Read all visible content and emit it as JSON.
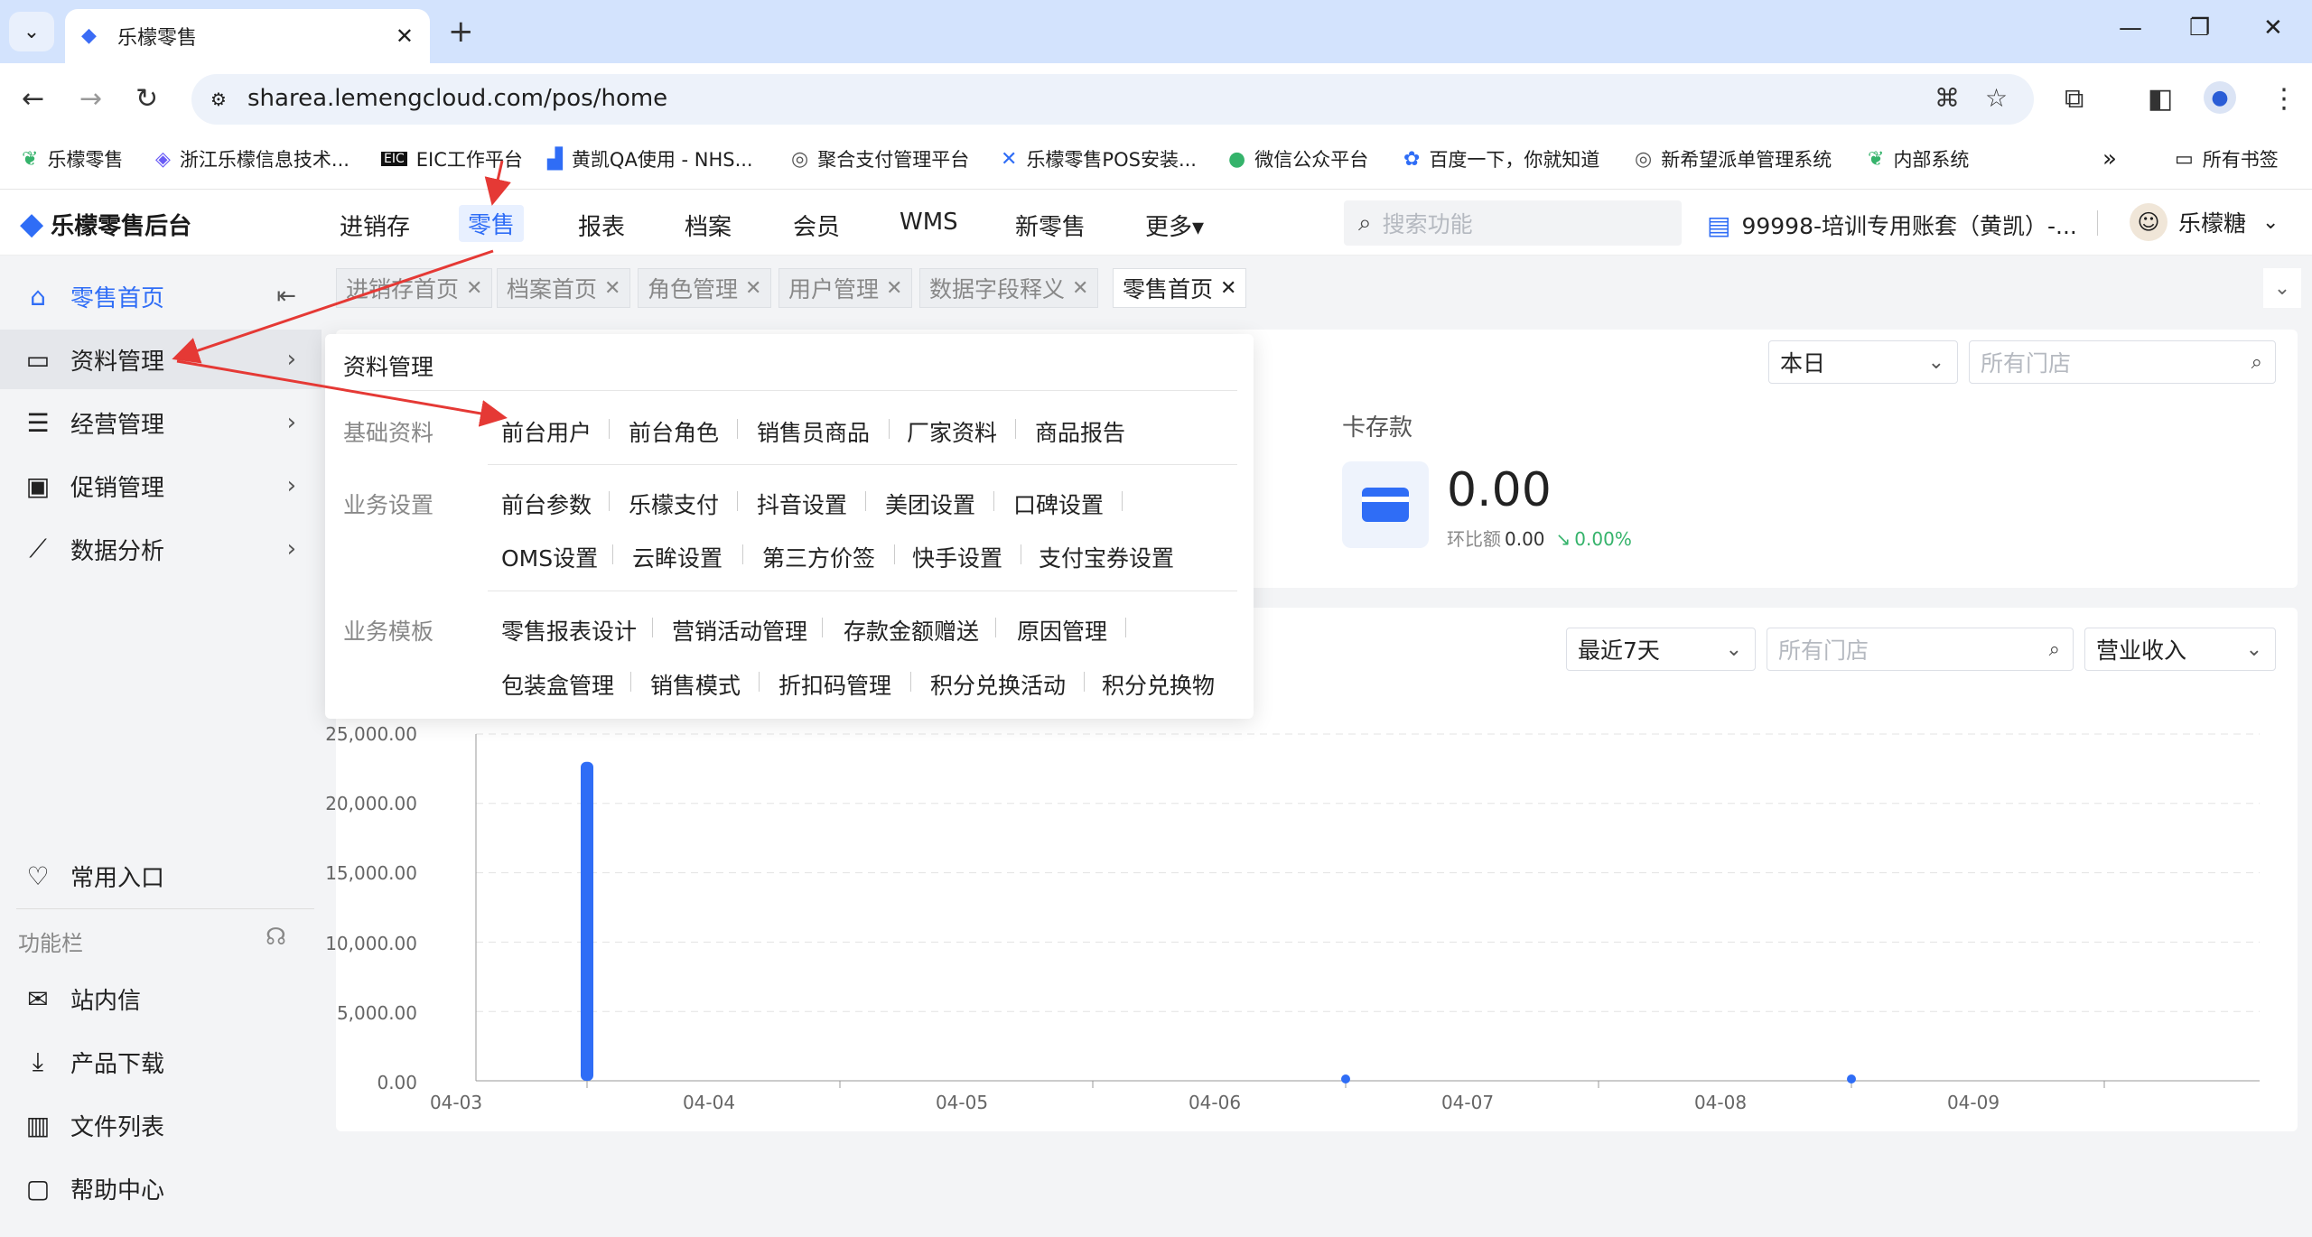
{
  "browser": {
    "tab_title": "乐檬零售",
    "url": "sharea.lemengcloud.com/pos/home",
    "bookmarks": [
      {
        "label": "乐檬零售",
        "icon": "lemon-leaf-icon"
      },
      {
        "label": "浙江乐檬信息技术...",
        "icon": "lemon-square-icon"
      },
      {
        "label": "EIC工作平台",
        "icon": "eic-icon"
      },
      {
        "label": "黄凯QA使用 - NHS...",
        "icon": "bar-icon"
      },
      {
        "label": "聚合支付管理平台",
        "icon": "globe-icon"
      },
      {
        "label": "乐檬零售POS安装...",
        "icon": "butterfly-icon"
      },
      {
        "label": "微信公众平台",
        "icon": "wechat-icon"
      },
      {
        "label": "百度一下，你就知道",
        "icon": "baidu-icon"
      },
      {
        "label": "新希望派单管理系统",
        "icon": "globe-icon"
      },
      {
        "label": "内部系统",
        "icon": "lemon-leaf-icon"
      }
    ],
    "all_bookmarks": "所有书签"
  },
  "app": {
    "brand": "乐檬零售后台",
    "nav": [
      "进销存",
      "零售",
      "报表",
      "档案",
      "会员",
      "WMS",
      "新零售",
      "更多▾"
    ],
    "search_placeholder": "搜索功能",
    "account": "99998-培训专用账套（黄凯）-...",
    "user": "乐檬糖"
  },
  "sidebar": {
    "items": [
      {
        "label": "零售首页",
        "icon": "home-icon"
      },
      {
        "label": "资料管理",
        "icon": "folder-icon"
      },
      {
        "label": "经营管理",
        "icon": "manage-icon"
      },
      {
        "label": "促销管理",
        "icon": "promo-icon"
      },
      {
        "label": "数据分析",
        "icon": "chart-line-icon"
      }
    ],
    "favorites": "常用入口",
    "section_label": "功能栏",
    "bottom_items": [
      {
        "label": "站内信",
        "icon": "mail-icon"
      },
      {
        "label": "产品下载",
        "icon": "download-icon"
      },
      {
        "label": "文件列表",
        "icon": "file-list-icon"
      },
      {
        "label": "帮助中心",
        "icon": "help-icon"
      }
    ]
  },
  "page_tabs": [
    "进销存首页",
    "档案首页",
    "角色管理",
    "用户管理",
    "数据字段释义",
    "零售首页"
  ],
  "dropdown": {
    "title": "资料管理",
    "groups": [
      {
        "label": "基础资料",
        "links": [
          "前台用户",
          "前台角色",
          "销售员商品",
          "厂家资料",
          "商品报告"
        ]
      },
      {
        "label": "业务设置",
        "links": [
          "前台参数",
          "乐檬支付",
          "抖音设置",
          "美团设置",
          "口碑设置",
          "OMS设置",
          "云眸设置",
          "第三方价签",
          "快手设置",
          "支付宝券设置"
        ]
      },
      {
        "label": "业务模板",
        "links": [
          "零售报表设计",
          "营销活动管理",
          "存款金额赠送",
          "原因管理",
          "包装盒管理",
          "销售模式",
          "折扣码管理",
          "积分兑换活动",
          "积分兑换物"
        ]
      }
    ]
  },
  "summary": {
    "period": "本日",
    "store_placeholder": "所有门店",
    "card_title": "卡存款",
    "value": "0.00",
    "compare_label": "环比额",
    "compare_value": "0.00",
    "compare_pct": "0.00%"
  },
  "trend": {
    "period": "最近7天",
    "store_placeholder": "所有门店",
    "metric": "营业收入"
  },
  "chart_data": {
    "type": "bar",
    "categories": [
      "04-03",
      "04-04",
      "04-05",
      "04-06",
      "04-07",
      "04-08",
      "04-09"
    ],
    "values": [
      23000,
      0,
      0,
      120,
      0,
      80,
      0
    ],
    "y_tick_labels": [
      "25,000.00",
      "20,000.00",
      "15,000.00",
      "10,000.00",
      "5,000.00",
      "0.00"
    ],
    "ylim": [
      0,
      25000
    ],
    "grid": true,
    "color": "#2f6df6"
  },
  "colors": {
    "accent": "#2f6df6",
    "annotation": "#e53935"
  }
}
